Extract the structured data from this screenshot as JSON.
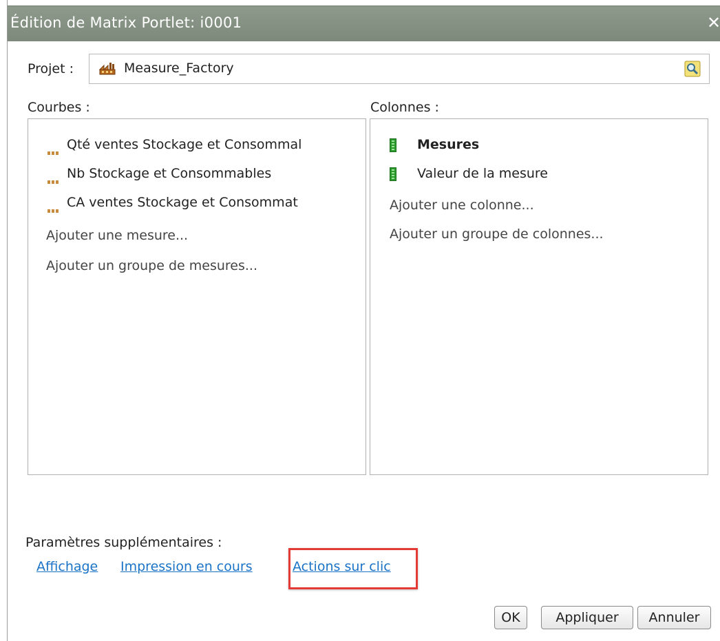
{
  "dialog": {
    "title": "Édition de Matrix Portlet: i0001",
    "close_glyph": "✕"
  },
  "project": {
    "label": "Projet :",
    "value": "Measure_Factory",
    "icon": "factory-icon",
    "browse_icon": "magnifier-icon"
  },
  "curves": {
    "header": "Courbes :",
    "items": [
      {
        "label": "Qté ventes Stockage et Consommal",
        "icon": "measure-dots-icon"
      },
      {
        "label": "Nb Stockage et Consommables",
        "icon": "measure-dots-icon"
      },
      {
        "label": "CA ventes Stockage et Consommat",
        "icon": "measure-dots-icon"
      }
    ],
    "add_measure": "Ajouter une mesure...",
    "add_measure_group": "Ajouter un groupe de mesures..."
  },
  "columns": {
    "header": "Colonnes :",
    "items": [
      {
        "label": "Mesures",
        "bold": true,
        "icon": "column-bar-icon"
      },
      {
        "label": "Valeur de la mesure",
        "bold": false,
        "icon": "column-bar-icon"
      }
    ],
    "add_column": "Ajouter une colonne...",
    "add_column_group": "Ajouter un groupe de colonnes..."
  },
  "extra": {
    "header": "Paramètres supplémentaires :",
    "links": [
      "Affichage",
      "Impression en cours",
      "Actions sur clic"
    ]
  },
  "buttons": {
    "ok": "OK",
    "apply": "Appliquer",
    "cancel": "Annuler"
  },
  "colors": {
    "titlebar": "#8e9a8c",
    "link": "#1a73c6",
    "highlight": "#e53935",
    "measure_icon": "#c88a3c",
    "column_icon": "#2c9a2c"
  }
}
